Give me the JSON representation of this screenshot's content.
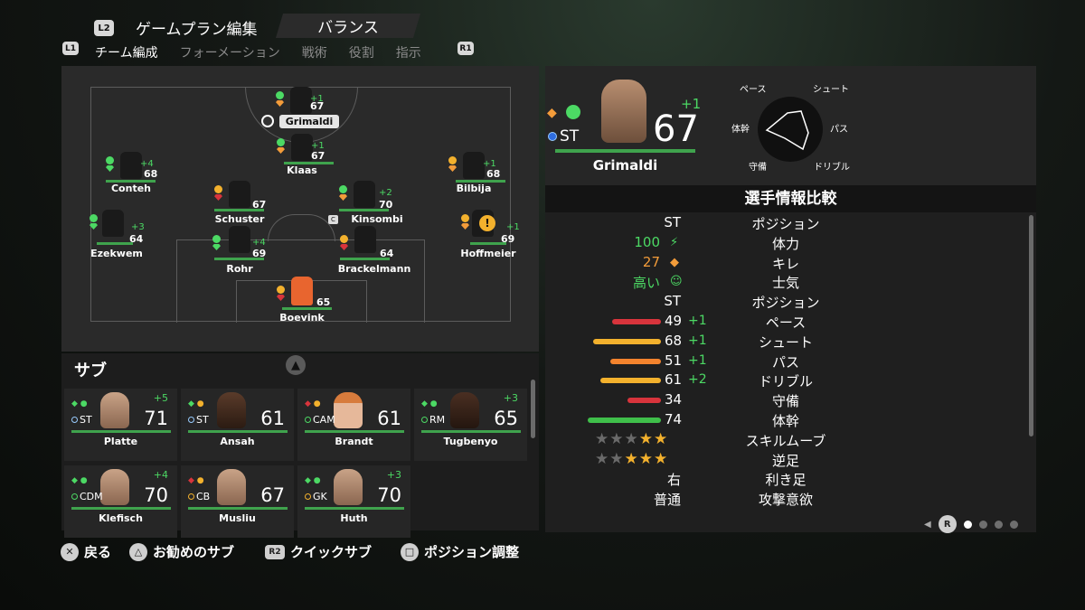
{
  "header": {
    "l2": "L2",
    "title": "ゲームプラン編集",
    "plan": "バランス",
    "l1": "L1",
    "r1": "R1"
  },
  "tabs": [
    {
      "label": "チーム編成",
      "active": true
    },
    {
      "label": "フォーメーション"
    },
    {
      "label": "戦術"
    },
    {
      "label": "役割"
    },
    {
      "label": "指示"
    }
  ],
  "pitch_players": [
    {
      "name": "Grimaldi",
      "ovr": "67",
      "plus": "+1",
      "selected": true
    },
    {
      "name": "Klaas",
      "ovr": "67",
      "plus": "+1"
    },
    {
      "name": "Conteh",
      "ovr": "68",
      "plus": "+4"
    },
    {
      "name": "Bilbija",
      "ovr": "68",
      "plus": "+1"
    },
    {
      "name": "Schuster",
      "ovr": "67",
      "plus": ""
    },
    {
      "name": "Kinsombi",
      "ovr": "70",
      "plus": "+2",
      "captain": "C"
    },
    {
      "name": "Ezekwem",
      "ovr": "64",
      "plus": "+3"
    },
    {
      "name": "Hoffmeier",
      "ovr": "69",
      "plus": "+1"
    },
    {
      "name": "Rohr",
      "ovr": "69",
      "plus": "+4"
    },
    {
      "name": "Brackelmann",
      "ovr": "64",
      "plus": ""
    },
    {
      "name": "Boevink",
      "ovr": "65",
      "plus": ""
    }
  ],
  "subs": {
    "title": "サブ",
    "players": [
      {
        "name": "Platte",
        "pos": "ST",
        "ovr": "71",
        "plus": "+5"
      },
      {
        "name": "Ansah",
        "pos": "ST",
        "ovr": "61",
        "plus": ""
      },
      {
        "name": "Brandt",
        "pos": "CAM",
        "ovr": "61",
        "plus": ""
      },
      {
        "name": "Tugbenyo",
        "pos": "RM",
        "ovr": "65",
        "plus": "+3"
      },
      {
        "name": "Klefisch",
        "pos": "CDM",
        "ovr": "70",
        "plus": "+4"
      },
      {
        "name": "Musliu",
        "pos": "CB",
        "ovr": "67",
        "plus": ""
      },
      {
        "name": "Huth",
        "pos": "GK",
        "ovr": "70",
        "plus": "+3"
      }
    ]
  },
  "selected": {
    "name": "Grimaldi",
    "pos": "ST",
    "ovr": "67",
    "plus": "+1",
    "radar": {
      "pace": "ペース",
      "shooting": "シュート",
      "physical": "体幹",
      "passing": "パス",
      "defending": "守備",
      "dribbling": "ドリブル"
    }
  },
  "compare": {
    "title": "選手情報比較",
    "rows": [
      {
        "val": "ST",
        "label": "ポジション"
      },
      {
        "val": "100",
        "label": "体力",
        "val_color": "#4cd964",
        "icon": "⚡"
      },
      {
        "val": "27",
        "label": "キレ",
        "val_color": "#f39c3a",
        "icon": "◆"
      },
      {
        "val": "高い",
        "label": "士気",
        "val_color": "#4cd964",
        "icon": "☺"
      },
      {
        "val": "ST",
        "label": "ポジション"
      },
      {
        "val": "49",
        "label": "ペース",
        "plus": "+1",
        "bar": 49,
        "bar_color": "#d8343c"
      },
      {
        "val": "68",
        "label": "シュート",
        "plus": "+1",
        "bar": 68,
        "bar_color": "#f3b12d"
      },
      {
        "val": "51",
        "label": "パス",
        "plus": "+1",
        "bar": 51,
        "bar_color": "#f3832d"
      },
      {
        "val": "61",
        "label": "ドリブル",
        "plus": "+2",
        "bar": 61,
        "bar_color": "#f3b12d"
      },
      {
        "val": "34",
        "label": "守備",
        "bar": 34,
        "bar_color": "#d8343c"
      },
      {
        "val": "74",
        "label": "体幹",
        "bar": 74,
        "bar_color": "#3fbf4a"
      },
      {
        "label": "スキルムーブ",
        "stars": 2
      },
      {
        "label": "逆足",
        "stars": 3
      },
      {
        "val": "右",
        "label": "利き足"
      },
      {
        "val": "普通",
        "label": "攻撃意欲"
      }
    ]
  },
  "pager": {
    "button": "R",
    "pages": 4,
    "current": 1
  },
  "footer": [
    {
      "btn": "✕",
      "label": "戻る"
    },
    {
      "btn": "△",
      "label": "お勧めのサブ"
    },
    {
      "btn": "R2",
      "label": "クイックサブ"
    },
    {
      "btn": "□",
      "label": "ポジション調整"
    }
  ],
  "colors": {
    "green": "#4cd964",
    "orange": "#f39c3a",
    "red": "#d8343c",
    "yellow": "#f3b12d"
  }
}
